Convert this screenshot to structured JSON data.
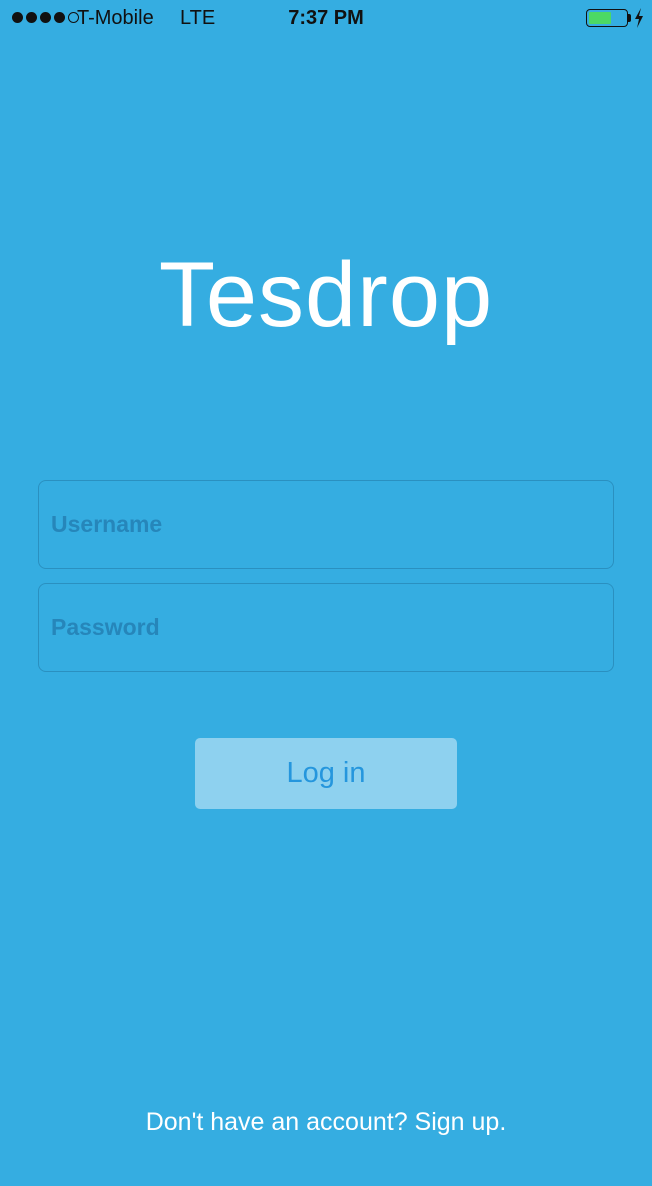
{
  "status_bar": {
    "signal_dots": [
      true,
      true,
      true,
      true,
      false
    ],
    "carrier": "T-Mobile",
    "network": "LTE",
    "time": "7:37 PM",
    "battery_level": 0.6,
    "charging": true
  },
  "app": {
    "title": "Tesdrop"
  },
  "form": {
    "username": {
      "placeholder": "Username",
      "value": ""
    },
    "password": {
      "placeholder": "Password",
      "value": ""
    },
    "login_label": "Log in"
  },
  "footer": {
    "signup_text": "Don't have an account? Sign up."
  },
  "colors": {
    "background": "#35ade1",
    "button_bg": "#8ed1ef",
    "button_text": "#2596dd",
    "battery": "#4cd964"
  }
}
